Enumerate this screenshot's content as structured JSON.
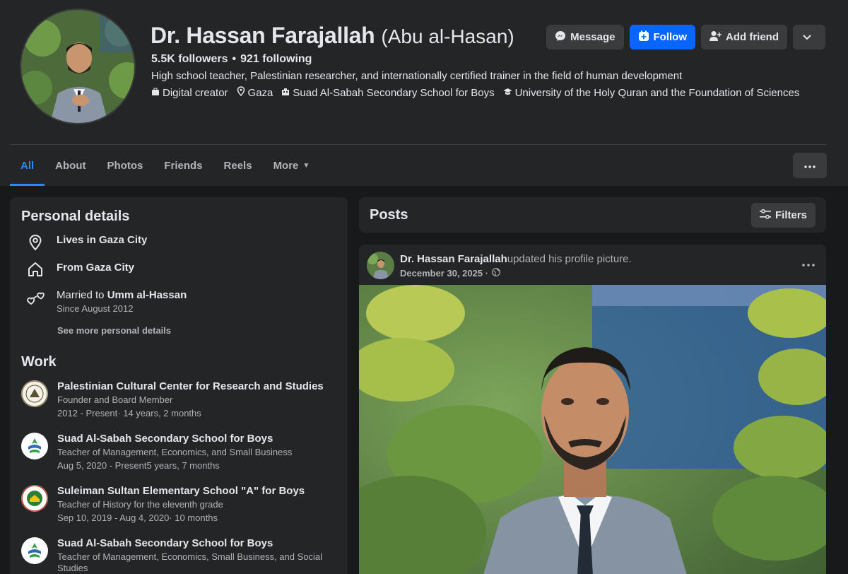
{
  "profile": {
    "name": "Dr. Hassan Farajallah",
    "alt_name": "(Abu al-Hasan)",
    "followers": "5.5K followers",
    "separator": "•",
    "following": "921 following",
    "bio": "High school teacher, Palestinian researcher, and internationally certified trainer in the field of human development",
    "intro": [
      {
        "icon": "briefcase-icon",
        "label": "Digital creator"
      },
      {
        "icon": "location-pin-icon",
        "label": "Gaza"
      },
      {
        "icon": "building-icon",
        "label": "Suad Al-Sabah Secondary School for Boys"
      },
      {
        "icon": "graduation-cap-icon",
        "label": "University of the Holy Quran and the Foundation of Sciences"
      }
    ]
  },
  "actions": {
    "message": "Message",
    "follow": "Follow",
    "add_friend": "Add friend"
  },
  "tabs": [
    {
      "label": "All",
      "active": true
    },
    {
      "label": "About"
    },
    {
      "label": "Photos"
    },
    {
      "label": "Friends"
    },
    {
      "label": "Reels"
    },
    {
      "label": "More"
    }
  ],
  "personal": {
    "title": "Personal details",
    "lives": "Lives in Gaza City",
    "from": "From Gaza City",
    "married_prefix": "Married to ",
    "spouse": "Umm al-Hassan",
    "married_since": "Since August 2012",
    "see_more": "See more personal details"
  },
  "work": {
    "title": "Work",
    "items": [
      {
        "title": "Palestinian Cultural Center for Research and Studies",
        "role": "Founder and Board Member",
        "date": "2012 - Present· 14 years, 2 months"
      },
      {
        "title": "Suad Al-Sabah Secondary School for Boys",
        "role": "Teacher of Management, Economics, and Small Business",
        "date": "Aug 5, 2020 - Present5 years, 7 months"
      },
      {
        "title": "Suleiman Sultan Elementary School \"A\" for Boys",
        "role": "Teacher of History for the eleventh grade",
        "date": "Sep 10, 2019 - Aug 4, 2020· 10 months"
      },
      {
        "title": "Suad Al-Sabah Secondary School for Boys",
        "role": "Teacher of Management, Economics, Small Business, and Social Studies",
        "date": ""
      }
    ]
  },
  "posts": {
    "title": "Posts",
    "filters": "Filters",
    "post": {
      "author": "Dr. Hassan Farajallah",
      "action": "updated his profile picture.",
      "date": "December 30, 2025 ·"
    }
  },
  "colors": {
    "accent": "#0866ff",
    "tab_active": "#2d88ff",
    "surface": "#242526",
    "background": "#18191a"
  }
}
